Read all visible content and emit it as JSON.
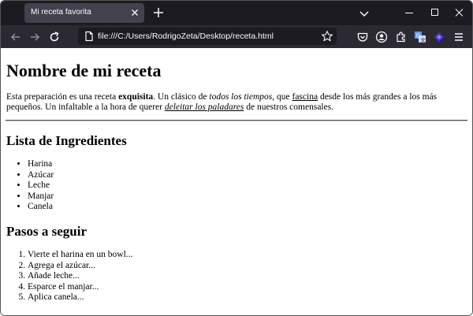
{
  "browser": {
    "tab_title": "Mi receta favorita",
    "url": "file:///C:/Users/RodrigoZeta/Desktop/receta.html"
  },
  "page": {
    "title": "Nombre de mi receta",
    "intro": {
      "s1": "Esta preparación es una receta ",
      "bold": "exquisita",
      "s2": ". Un clásico de ",
      "italic": "todos los tiempos",
      "s3": ", que ",
      "link": "fascina",
      "s4": " desde los más grandes a los más pequeños. Un infaltable a la hora de querer ",
      "italic_link": "deleitar los paladares",
      "s5": " de nuestros comensales."
    },
    "ingredients_heading": "Lista de Ingredientes",
    "ingredients": [
      "Harina",
      "Azúcar",
      "Leche",
      "Manjar",
      "Canela"
    ],
    "steps_heading": "Pasos a seguir",
    "steps": [
      "Vierte el harina en un bowl...",
      "Agrega el azúcar...",
      "Añade leche...",
      "Esparce el manjar...",
      "Aplica canela..."
    ]
  }
}
